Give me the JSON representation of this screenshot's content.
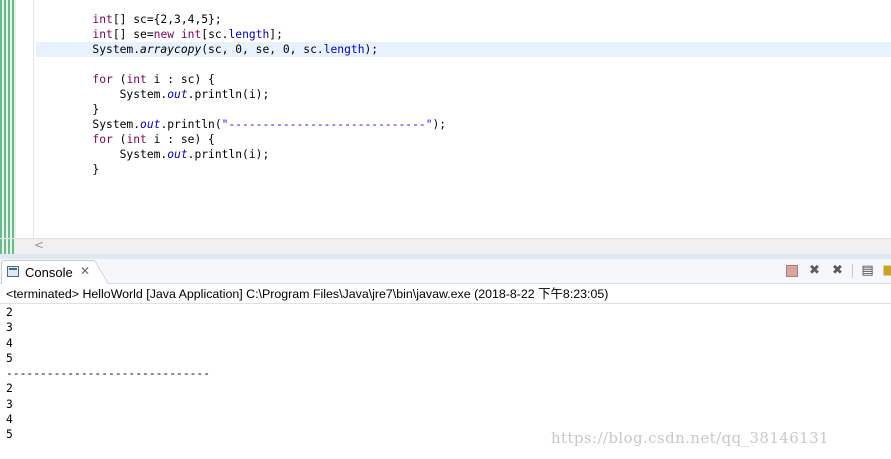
{
  "editor": {
    "code_lines": [
      [
        {
          "t": "        "
        },
        {
          "t": "int",
          "c": "kw"
        },
        {
          "t": "[] sc={2,3,4,5};"
        }
      ],
      [
        {
          "t": "        "
        },
        {
          "t": "int",
          "c": "kw"
        },
        {
          "t": "[] se="
        },
        {
          "t": "new",
          "c": "kw"
        },
        {
          "t": " "
        },
        {
          "t": "int",
          "c": "kw"
        },
        {
          "t": "[sc."
        },
        {
          "t": "length",
          "c": "fld"
        },
        {
          "t": "];"
        }
      ],
      [
        {
          "t": "        System."
        },
        {
          "t": "arraycopy",
          "c": "it"
        },
        {
          "t": "(sc, 0, se, 0, sc."
        },
        {
          "t": "length",
          "c": "fld"
        },
        {
          "t": ");"
        }
      ],
      [
        {
          "t": ""
        }
      ],
      [
        {
          "t": "        "
        },
        {
          "t": "for",
          "c": "kw"
        },
        {
          "t": " ("
        },
        {
          "t": "int",
          "c": "kw"
        },
        {
          "t": " i : sc) {"
        }
      ],
      [
        {
          "t": "            System."
        },
        {
          "t": "out",
          "c": "fld it"
        },
        {
          "t": ".println(i);"
        }
      ],
      [
        {
          "t": "        }"
        }
      ],
      [
        {
          "t": "        System."
        },
        {
          "t": "out",
          "c": "fld it"
        },
        {
          "t": ".println("
        },
        {
          "t": "\"-----------------------------\"",
          "c": "str"
        },
        {
          "t": ");"
        }
      ],
      [
        {
          "t": "        "
        },
        {
          "t": "for",
          "c": "kw"
        },
        {
          "t": " ("
        },
        {
          "t": "int",
          "c": "kw"
        },
        {
          "t": " i : se) {"
        }
      ],
      [
        {
          "t": "            System."
        },
        {
          "t": "out",
          "c": "fld it"
        },
        {
          "t": ".println(i);"
        }
      ],
      [
        {
          "t": "        }"
        }
      ]
    ],
    "scroll_left_glyph": "<"
  },
  "console": {
    "tab_label": "Console",
    "close_glyph": "✕",
    "status": "<terminated> HelloWorld [Java Application] C:\\Program Files\\Java\\jre7\\bin\\javaw.exe (2018-8-22 下午8:23:05)",
    "output_lines": [
      "2",
      "3",
      "4",
      "5",
      "------------------------------",
      "2",
      "3",
      "4",
      "5"
    ],
    "toolbar_icons": [
      "terminate-icon",
      "remove-launch-icon",
      "remove-all-terminated-icon",
      "clear-console-icon",
      "scroll-lock-icon"
    ]
  },
  "watermark": "https://blog.csdn.net/qq_38146131"
}
